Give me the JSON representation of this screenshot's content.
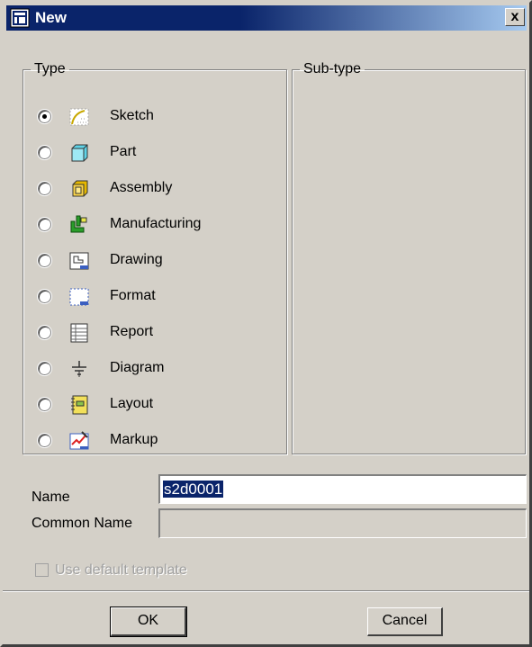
{
  "window": {
    "title": "New",
    "close_label": "x"
  },
  "type_group": {
    "legend": "Type",
    "selected": "Sketch",
    "items": [
      {
        "label": "Sketch",
        "icon": "sketch-icon",
        "selected": true
      },
      {
        "label": "Part",
        "icon": "part-icon",
        "selected": false
      },
      {
        "label": "Assembly",
        "icon": "assembly-icon",
        "selected": false
      },
      {
        "label": "Manufacturing",
        "icon": "manufacturing-icon",
        "selected": false
      },
      {
        "label": "Drawing",
        "icon": "drawing-icon",
        "selected": false
      },
      {
        "label": "Format",
        "icon": "format-icon",
        "selected": false
      },
      {
        "label": "Report",
        "icon": "report-icon",
        "selected": false
      },
      {
        "label": "Diagram",
        "icon": "diagram-icon",
        "selected": false
      },
      {
        "label": "Layout",
        "icon": "layout-icon",
        "selected": false
      },
      {
        "label": "Markup",
        "icon": "markup-icon",
        "selected": false
      }
    ]
  },
  "subtype_group": {
    "legend": "Sub-type"
  },
  "name_field": {
    "label": "Name",
    "value": "s2d0001"
  },
  "common_name_field": {
    "label": "Common Name",
    "value": ""
  },
  "use_default_template": {
    "label": "Use default template",
    "checked": false,
    "enabled": false
  },
  "buttons": {
    "ok": "OK",
    "cancel": "Cancel"
  },
  "colors": {
    "title_bar": "#0a246a",
    "dialog_face": "#d4d0c8",
    "selection": "#0a246a"
  }
}
